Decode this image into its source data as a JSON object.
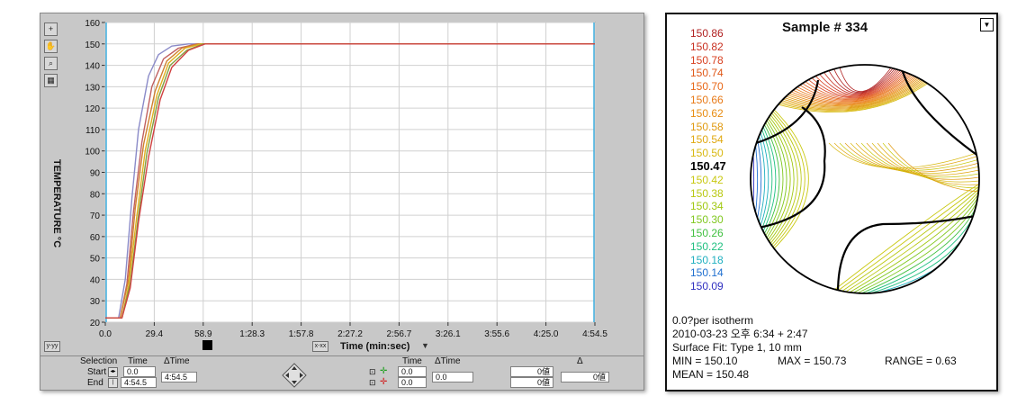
{
  "left_panel": {
    "y_axis_title": "TEMPERATURE °C",
    "x_axis_title": "Time (min:sec)",
    "xy_button_label": "y-yy",
    "xx_button_label": "x-xx",
    "y_ticks": [
      "160",
      "150",
      "140",
      "130",
      "120",
      "110",
      "100",
      "90",
      "80",
      "70",
      "60",
      "50",
      "40",
      "30",
      "20"
    ],
    "x_ticks": [
      "0.0",
      "29.4",
      "58.9",
      "1:28.3",
      "1:57.8",
      "2:27.2",
      "2:56.7",
      "3:26.1",
      "3:55.6",
      "4:25.0",
      "4:54.5"
    ],
    "tool_icons": [
      "crosshair-icon",
      "hand-icon",
      "zoom-icon",
      "zoom-rect-icon"
    ],
    "controls": {
      "selection_label": "Selection",
      "time_label": "Time",
      "dtime_label": "ΔTime",
      "start_label": "Start",
      "end_label": "End",
      "start_value": "0.0",
      "end_value": "4:54.5",
      "dtime_value": "4:54.5",
      "time2_label": "Time",
      "dtime2_label": "ΔTime",
      "cursor1_time": "0.0",
      "cursor2_time": "0.0",
      "cursor_dtime": "0.0",
      "val1": "0値",
      "val2": "0値",
      "delta_label": "Δ",
      "delta_value": "0値"
    }
  },
  "chart_data": {
    "type": "line",
    "title": "",
    "xlabel": "Time (min:sec)",
    "ylabel": "TEMPERATURE °C",
    "xlim_seconds": [
      0,
      294.5
    ],
    "ylim": [
      20,
      160
    ],
    "grid": true,
    "series_description_count": 12,
    "series": [
      {
        "color": "#8a8ac8",
        "x": [
          0,
          8,
          12,
          16,
          20,
          26,
          32,
          40,
          50,
          60,
          294.5
        ],
        "y": [
          22,
          22,
          40,
          78,
          110,
          135,
          145,
          149,
          150,
          150,
          150
        ]
      },
      {
        "color": "#c06060",
        "x": [
          0,
          9,
          13,
          17,
          22,
          28,
          35,
          44,
          55,
          65,
          294.5
        ],
        "y": [
          22,
          22,
          38,
          72,
          104,
          130,
          143,
          148,
          150,
          150,
          150
        ]
      },
      {
        "color": "#d08030",
        "x": [
          0,
          9,
          14,
          18,
          23,
          30,
          37,
          46,
          56,
          66,
          294.5
        ],
        "y": [
          22,
          22,
          40,
          73,
          103,
          128,
          142,
          148,
          150,
          150,
          150
        ]
      },
      {
        "color": "#e0b020",
        "x": [
          0,
          10,
          14,
          19,
          24,
          31,
          38,
          48,
          58,
          68,
          294.5
        ],
        "y": [
          22,
          22,
          37,
          70,
          100,
          126,
          141,
          148,
          150,
          150,
          150
        ]
      },
      {
        "color": "#80a040",
        "x": [
          0,
          10,
          15,
          20,
          25,
          32,
          39,
          49,
          59,
          69,
          294.5
        ],
        "y": [
          22,
          22,
          38,
          70,
          99,
          125,
          140,
          147,
          150,
          150,
          150
        ]
      },
      {
        "color": "#d04040",
        "x": [
          0,
          10,
          15,
          20,
          26,
          33,
          40,
          50,
          60,
          70,
          294.5
        ],
        "y": [
          22,
          22,
          36,
          67,
          97,
          124,
          139,
          147,
          150,
          150,
          150
        ]
      }
    ]
  },
  "right_panel": {
    "title": "Sample # 334",
    "legend": [
      {
        "value": "150.86",
        "color": "#b02020"
      },
      {
        "value": "150.82",
        "color": "#c83020"
      },
      {
        "value": "150.78",
        "color": "#d84020"
      },
      {
        "value": "150.74",
        "color": "#e05818"
      },
      {
        "value": "150.70",
        "color": "#e86818"
      },
      {
        "value": "150.66",
        "color": "#e87a18"
      },
      {
        "value": "150.62",
        "color": "#e88c10"
      },
      {
        "value": "150.58",
        "color": "#e09a10"
      },
      {
        "value": "150.54",
        "color": "#e0a810"
      },
      {
        "value": "150.50",
        "color": "#d8b810"
      },
      {
        "value": "150.47",
        "color": "#000000",
        "bold": true
      },
      {
        "value": "150.42",
        "color": "#c8c810"
      },
      {
        "value": "150.38",
        "color": "#b8c810"
      },
      {
        "value": "150.34",
        "color": "#a0c810"
      },
      {
        "value": "150.30",
        "color": "#80c820"
      },
      {
        "value": "150.26",
        "color": "#40c040"
      },
      {
        "value": "150.22",
        "color": "#20c080"
      },
      {
        "value": "150.18",
        "color": "#20b0c0"
      },
      {
        "value": "150.14",
        "color": "#2070d0"
      },
      {
        "value": "150.09",
        "color": "#3030c0"
      }
    ],
    "info": {
      "line1": "0.0?per isotherm",
      "line2": "2010-03-23 오후 6:34 + 2:47",
      "line3": "Surface Fit: Type 1, 10 mm",
      "min": "MIN = 150.10",
      "max": "MAX = 150.73",
      "range": "RANGE = 0.63",
      "mean": "MEAN = 150.48"
    }
  }
}
